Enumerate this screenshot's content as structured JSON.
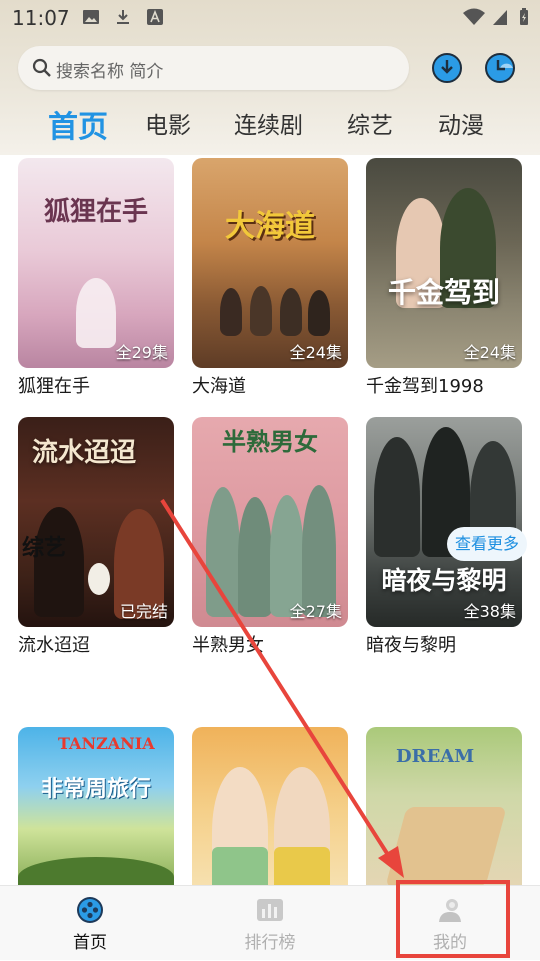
{
  "status_bar": {
    "time": "11:07"
  },
  "search": {
    "placeholder": "搜索名称 简介"
  },
  "tabs": [
    {
      "label": "首页"
    },
    {
      "label": "电影"
    },
    {
      "label": "连续剧"
    },
    {
      "label": "综艺"
    },
    {
      "label": "动漫"
    }
  ],
  "shows": [
    {
      "title": "狐狸在手",
      "badge": "全29集",
      "poster_text": "狐狸在手"
    },
    {
      "title": "大海道",
      "badge": "全24集",
      "poster_text": "大海道"
    },
    {
      "title": "千金驾到1998",
      "badge": "全24集",
      "poster_text": "千金驾到"
    },
    {
      "title": "流水迢迢",
      "badge": "已完结",
      "poster_text": "流水迢迢"
    },
    {
      "title": "半熟男女",
      "badge": "全27集",
      "poster_text": "半熟男女"
    },
    {
      "title": "暗夜与黎明",
      "badge": "全38集",
      "poster_text": "暗夜与黎明"
    }
  ],
  "variety_section": {
    "title": "综艺",
    "more_label": "查看更多",
    "items": [
      {
        "poster_text": "非常周旅行",
        "poster_subtext": "TANZANIA"
      },
      {
        "poster_text": ""
      },
      {
        "poster_text": "DREAM"
      }
    ]
  },
  "bottom_nav": [
    {
      "label": "首页",
      "icon": "home-film-icon",
      "active": true
    },
    {
      "label": "排行榜",
      "icon": "ranking-chart-icon",
      "active": false
    },
    {
      "label": "我的",
      "icon": "user-profile-icon",
      "active": false
    }
  ],
  "colors": {
    "accent": "#2193e3",
    "annotation": "#e8453c"
  }
}
